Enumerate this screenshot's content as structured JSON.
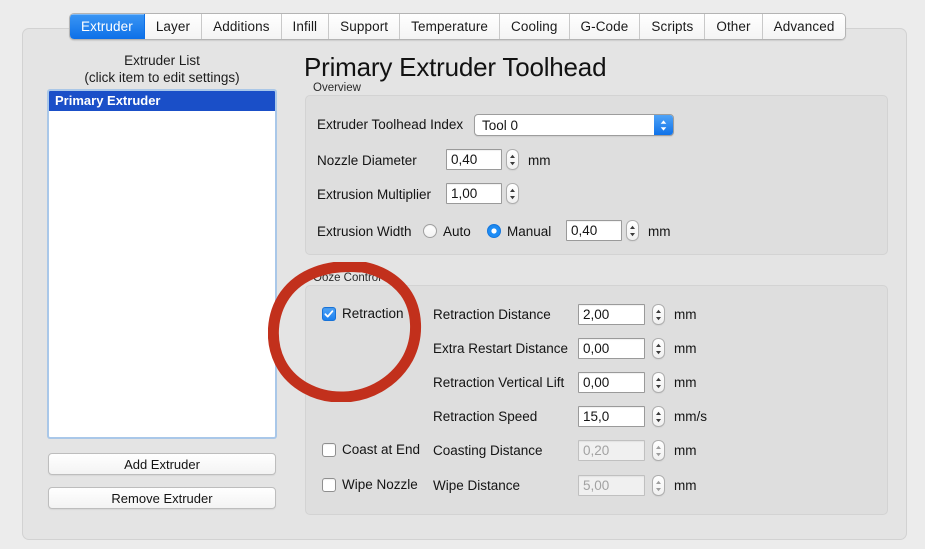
{
  "app": {
    "title": "Primary Extruder Toolhead"
  },
  "tabs": [
    {
      "label": "Extruder",
      "active": true
    },
    {
      "label": "Layer",
      "active": false
    },
    {
      "label": "Additions",
      "active": false
    },
    {
      "label": "Infill",
      "active": false
    },
    {
      "label": "Support",
      "active": false
    },
    {
      "label": "Temperature",
      "active": false
    },
    {
      "label": "Cooling",
      "active": false
    },
    {
      "label": "G-Code",
      "active": false
    },
    {
      "label": "Scripts",
      "active": false
    },
    {
      "label": "Other",
      "active": false
    },
    {
      "label": "Advanced",
      "active": false
    }
  ],
  "sidebar": {
    "header_line1": "Extruder List",
    "header_line2": "(click item to edit settings)",
    "items": [
      {
        "label": "Primary Extruder",
        "selected": true
      }
    ],
    "add_button": "Add Extruder",
    "remove_button": "Remove Extruder"
  },
  "overview": {
    "group_label": "Overview",
    "toolhead_index": {
      "label": "Extruder Toolhead Index",
      "value": "Tool 0",
      "options": [
        "Tool 0"
      ]
    },
    "nozzle_diameter": {
      "label": "Nozzle Diameter",
      "value": "0,40",
      "unit": "mm"
    },
    "extrusion_multiplier": {
      "label": "Extrusion Multiplier",
      "value": "1,00",
      "unit": ""
    },
    "extrusion_width": {
      "label": "Extrusion Width",
      "auto_label": "Auto",
      "manual_label": "Manual",
      "mode": "Manual",
      "value": "0,40",
      "unit": "mm"
    }
  },
  "ooze_control": {
    "group_label": "Ooze Control",
    "retraction": {
      "label": "Retraction",
      "checked": true
    },
    "retraction_distance": {
      "label": "Retraction Distance",
      "value": "2,00",
      "unit": "mm",
      "enabled": true
    },
    "extra_restart_distance": {
      "label": "Extra Restart Distance",
      "value": "0,00",
      "unit": "mm",
      "enabled": true
    },
    "retraction_vertical_lift": {
      "label": "Retraction Vertical Lift",
      "value": "0,00",
      "unit": "mm",
      "enabled": true
    },
    "retraction_speed": {
      "label": "Retraction Speed",
      "value": "15,0",
      "unit": "mm/s",
      "enabled": true
    },
    "coast_at_end": {
      "label": "Coast at End",
      "checked": false
    },
    "coasting_distance": {
      "label": "Coasting Distance",
      "value": "0,20",
      "unit": "mm",
      "enabled": false
    },
    "wipe_nozzle": {
      "label": "Wipe Nozzle",
      "checked": false
    },
    "wipe_distance": {
      "label": "Wipe Distance",
      "value": "5,00",
      "unit": "mm",
      "enabled": false
    }
  },
  "annotation": {
    "shape": "hand-drawn-ellipse",
    "color": "#c2301c",
    "target": "retraction-checkbox"
  },
  "colors": {
    "accent_blue": "#0d70e8",
    "selection_blue": "#1a4fc8",
    "window_bg": "#e4e4e4",
    "group_bg": "#dedede",
    "annotation_red": "#c2301c"
  }
}
